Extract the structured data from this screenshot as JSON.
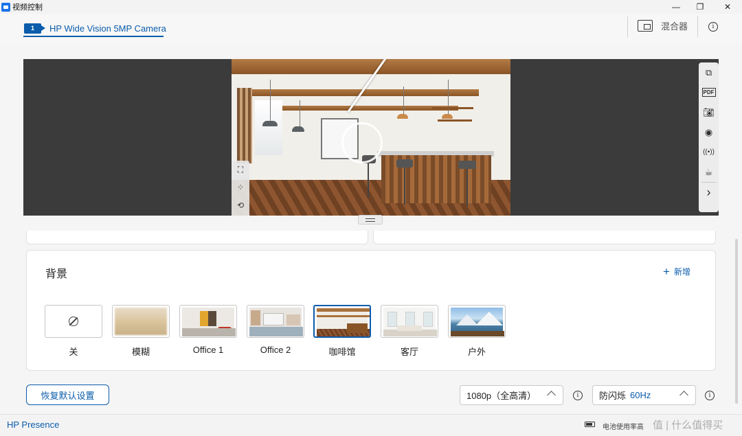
{
  "window": {
    "title": "视频控制",
    "minimize": "—",
    "restore": "❐",
    "close": "✕"
  },
  "header": {
    "camera_badge": "1",
    "camera_name": "HP Wide Vision 5MP Camera",
    "mixer_label": "混合器",
    "info_icon": "i"
  },
  "preview": {
    "left_tools": [
      "frame-text-icon",
      "adjust-points-icon",
      "rotate-icon"
    ],
    "right_tools": [
      "pip-icon",
      "pdf-icon",
      "camera-icon",
      "record-icon",
      "broadcast-icon",
      "coffee-icon",
      "chevron-right-icon"
    ]
  },
  "background_section": {
    "title": "背景",
    "add_label": "新增",
    "items": [
      {
        "label": "关",
        "selected": false
      },
      {
        "label": "模糊",
        "selected": false
      },
      {
        "label": "Office 1",
        "selected": false
      },
      {
        "label": "Office 2",
        "selected": false
      },
      {
        "label": "咖啡馆",
        "selected": true
      },
      {
        "label": "客厅",
        "selected": false
      },
      {
        "label": "户外",
        "selected": false
      }
    ]
  },
  "controls": {
    "reset_label": "恢复默认设置",
    "resolution_value": "1080p（全高清）",
    "flicker_label": "防闪烁",
    "flicker_value": "60Hz"
  },
  "status": {
    "brand": "HP Presence",
    "battery_text": "电池使用率高",
    "watermark": "值 | 什么值得买"
  },
  "colors": {
    "accent": "#0b5cab"
  }
}
